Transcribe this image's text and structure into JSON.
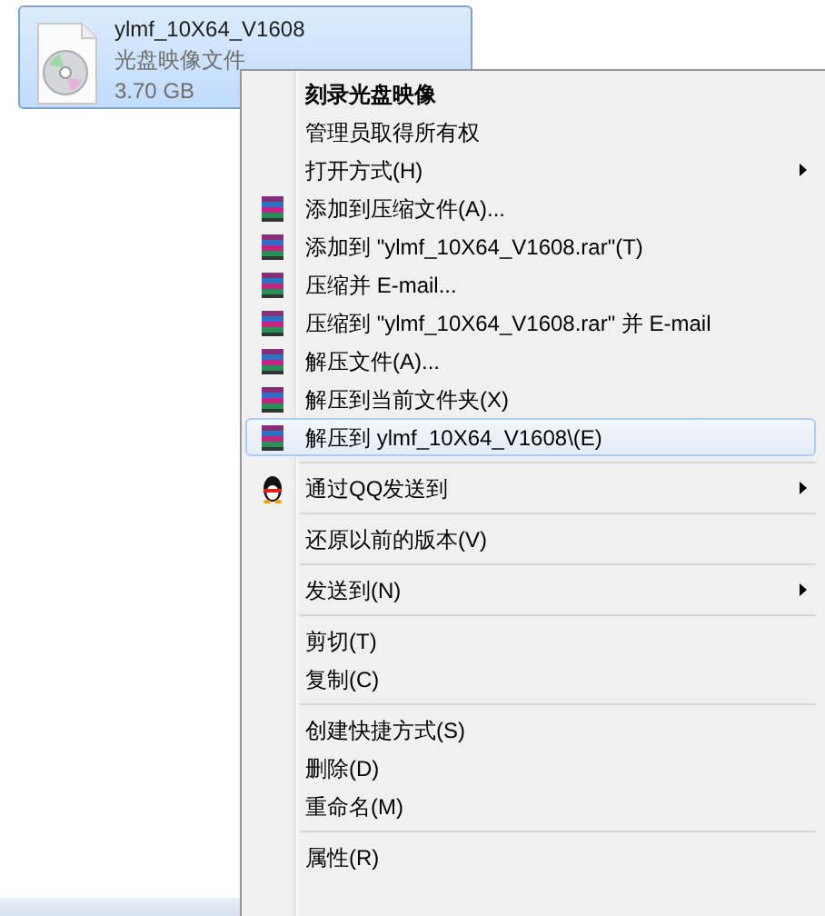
{
  "file": {
    "name": "ylmf_10X64_V1608",
    "type": "光盘映像文件",
    "size": "3.70 GB",
    "selected": true
  },
  "context_menu": {
    "groups": [
      {
        "items": [
          {
            "label": "刻录光盘映像",
            "default": true,
            "selected": false
          },
          {
            "label": "管理员取得所有权",
            "selected": false
          },
          {
            "label": "打开方式(H)",
            "submenu": true,
            "selected": false
          },
          {
            "label": "添加到压缩文件(A)...",
            "kind": "winrar",
            "selected": false
          },
          {
            "label": "添加到 \"ylmf_10X64_V1608.rar\"(T)",
            "kind": "winrar",
            "selected": false
          },
          {
            "label": "压缩并 E-mail...",
            "kind": "winrar",
            "selected": false
          },
          {
            "label": "压缩到 \"ylmf_10X64_V1608.rar\" 并 E-mail",
            "kind": "winrar",
            "selected": false
          },
          {
            "label": "解压文件(A)...",
            "kind": "winrar",
            "selected": false
          },
          {
            "label": "解压到当前文件夹(X)",
            "kind": "winrar",
            "selected": false
          },
          {
            "label": "解压到 ylmf_10X64_V1608\\(E)",
            "kind": "winrar",
            "selected": true
          }
        ]
      },
      {
        "items": [
          {
            "label": "通过QQ发送到",
            "kind": "qq",
            "submenu": true,
            "selected": false
          }
        ]
      },
      {
        "items": [
          {
            "label": "还原以前的版本(V)",
            "selected": false
          }
        ]
      },
      {
        "items": [
          {
            "label": "发送到(N)",
            "submenu": true,
            "selected": false
          }
        ]
      },
      {
        "items": [
          {
            "label": "剪切(T)",
            "selected": false
          },
          {
            "label": "复制(C)",
            "selected": false
          }
        ]
      },
      {
        "items": [
          {
            "label": "创建快捷方式(S)",
            "selected": false
          },
          {
            "label": "删除(D)",
            "selected": false
          },
          {
            "label": "重命名(M)",
            "selected": false
          }
        ]
      },
      {
        "items": [
          {
            "label": "属性(R)",
            "selected": false
          }
        ]
      }
    ]
  }
}
